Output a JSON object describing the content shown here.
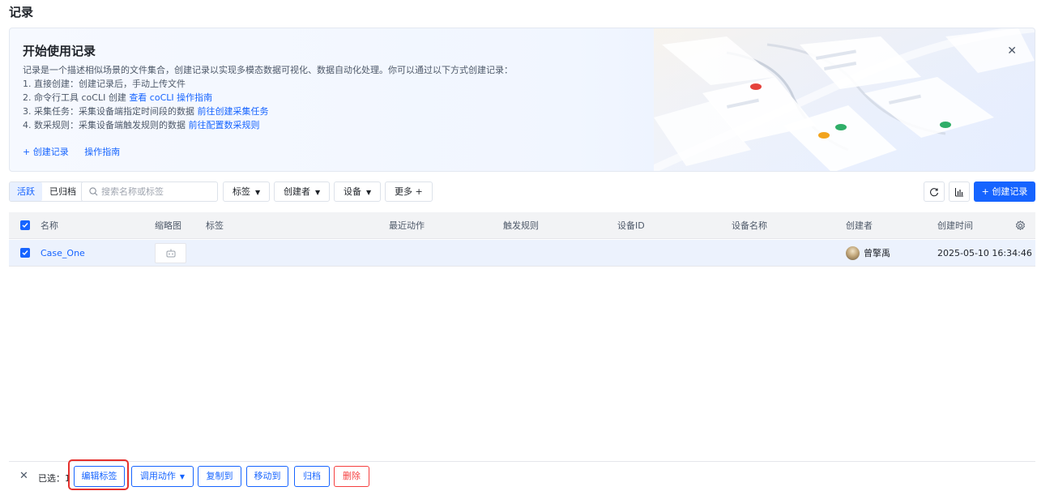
{
  "page_title": "记录",
  "banner": {
    "title": "开始使用记录",
    "description": "记录是一个描述相似场景的文件集合，创建记录以实现多模态数据可视化、数据自动化处理。你可以通过以下方式创建记录：",
    "lines": [
      {
        "text": "1. 直接创建：创建记录后，手动上传文件",
        "link": ""
      },
      {
        "text": "2. 命令行工具 coCLI 创建 ",
        "link": "查看 coCLI 操作指南"
      },
      {
        "text": "3. 采集任务：采集设备端指定时间段的数据 ",
        "link": "前往创建采集任务"
      },
      {
        "text": "4. 数采规则：采集设备端触发规则的数据 ",
        "link": "前往配置数采规则"
      }
    ],
    "create_link": "+ 创建记录",
    "guide_link": "操作指南",
    "close_icon": "close-icon"
  },
  "filters": {
    "tabs": [
      "活跃",
      "已归档"
    ],
    "active_tab": "活跃",
    "search_placeholder": "搜索名称或标签",
    "tag_label": "标签",
    "creator_label": "创建者",
    "device_label": "设备",
    "more_label": "更多 +",
    "create_button": "+ 创建记录"
  },
  "table": {
    "columns": [
      "名称",
      "缩略图",
      "标签",
      "最近动作",
      "触发规则",
      "设备ID",
      "设备名称",
      "创建者",
      "创建时间"
    ],
    "rows": [
      {
        "name": "Case_One",
        "tags": "",
        "last_action": "",
        "trigger_rule": "",
        "device_id": "",
        "device_name": "",
        "creator": "曾擎禹",
        "created_at": "2025-05-10 16:34:46",
        "selected": true
      }
    ]
  },
  "footer": {
    "selected_text": "已选：1",
    "actions": [
      "编辑标签",
      "调用动作",
      "复制到",
      "移动到",
      "归档",
      "删除"
    ]
  },
  "colors": {
    "primary": "#1664ff",
    "danger": "#f53f3f",
    "highlight": "#e5302d"
  }
}
